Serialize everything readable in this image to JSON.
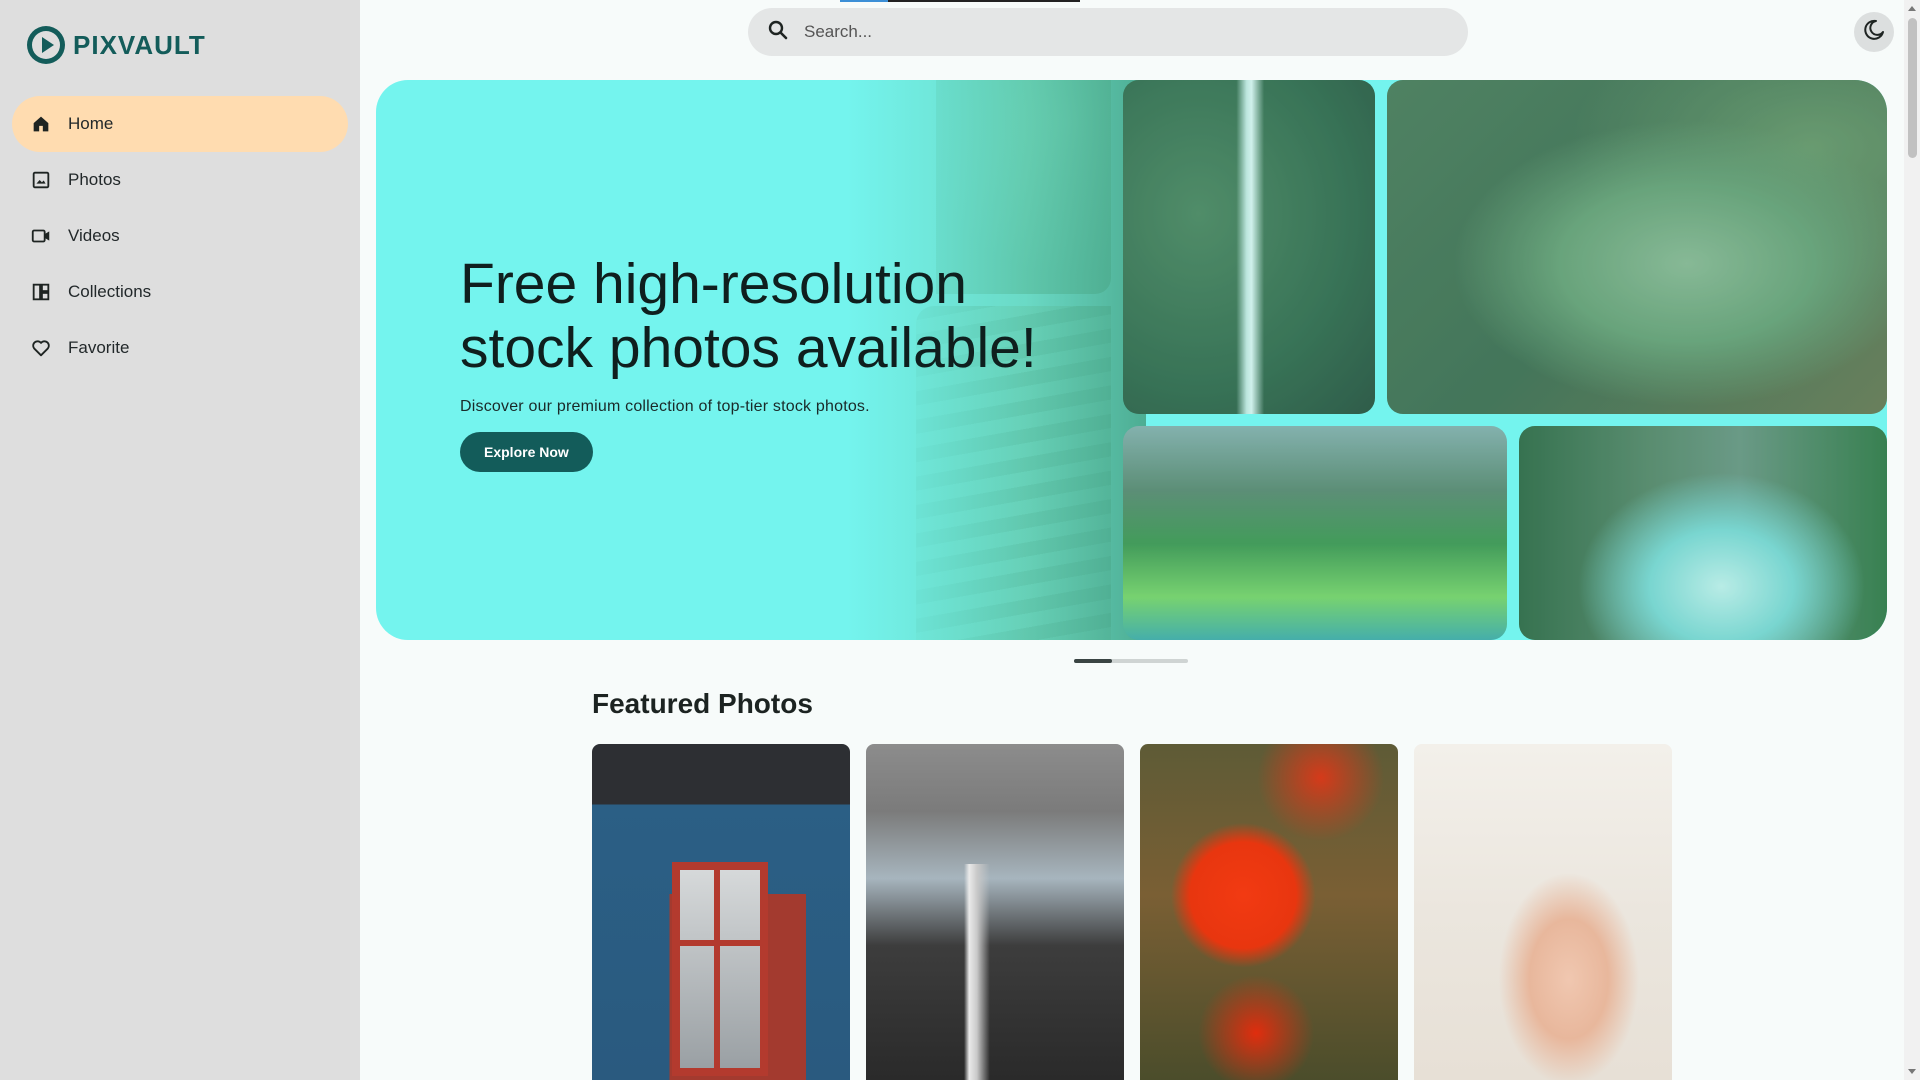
{
  "brand": {
    "name": "PIXVAULT"
  },
  "search": {
    "placeholder": "Search..."
  },
  "nav": {
    "items": [
      {
        "label": "Home",
        "icon": "home-icon",
        "active": true
      },
      {
        "label": "Photos",
        "icon": "photo-icon",
        "active": false
      },
      {
        "label": "Videos",
        "icon": "video-icon",
        "active": false
      },
      {
        "label": "Collections",
        "icon": "collections-icon",
        "active": false
      },
      {
        "label": "Favorite",
        "icon": "heart-icon",
        "active": false
      }
    ]
  },
  "hero": {
    "title_line1": "Free high-resolution",
    "title_line2": "stock photos available!",
    "subtitle": "Discover our premium collection of top-tier stock photos.",
    "cta_label": "Explore Now",
    "slides_total": 3,
    "active_slide": 1
  },
  "featured": {
    "title": "Featured Photos"
  },
  "colors": {
    "accent": "#135c5a",
    "hero_bg": "#74f4ee",
    "active_nav": "#ffdcb0",
    "sidebar_bg": "#dedede"
  },
  "icons": {
    "theme_toggle": "moon-icon",
    "search": "search-icon"
  }
}
